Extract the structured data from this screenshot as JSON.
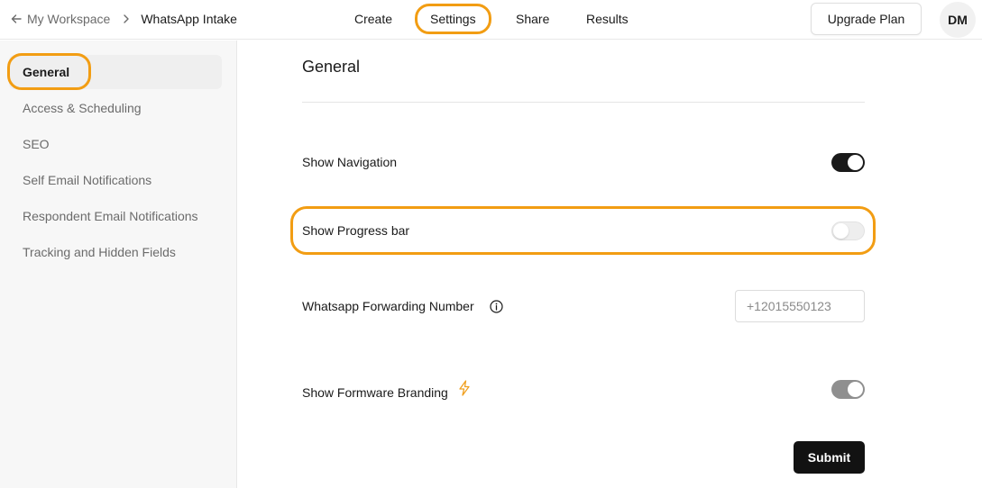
{
  "header": {
    "breadcrumb": {
      "workspace": "My Workspace",
      "form": "WhatsApp Intake"
    },
    "tabs": {
      "create": "Create",
      "settings": "Settings",
      "share": "Share",
      "results": "Results"
    },
    "upgrade_label": "Upgrade Plan",
    "avatar_initials": "DM"
  },
  "sidebar": {
    "items": [
      {
        "label": "General",
        "active": true
      },
      {
        "label": "Access & Scheduling"
      },
      {
        "label": "SEO"
      },
      {
        "label": "Self Email Notifications"
      },
      {
        "label": "Respondent Email Notifications"
      },
      {
        "label": "Tracking and Hidden Fields"
      }
    ]
  },
  "main": {
    "title": "General",
    "show_navigation": {
      "label": "Show Navigation",
      "state": "on"
    },
    "show_progress": {
      "label": "Show Progress bar",
      "state": "off"
    },
    "whatsapp": {
      "label": "Whatsapp Forwarding Number",
      "placeholder": "+12015550123",
      "value": ""
    },
    "branding": {
      "label": "Show Formware Branding",
      "state": "on-disabled"
    },
    "submit_label": "Submit"
  },
  "colors": {
    "accent_highlight": "#f29d13",
    "toggle_on": "#1a1a1a",
    "toggle_disabled": "#8f8f8f",
    "primary_button": "#121212"
  },
  "icons": {
    "back": "arrow-left-icon",
    "separator": "chevron-right-icon",
    "info": "info-icon",
    "premium": "lightning-icon"
  }
}
